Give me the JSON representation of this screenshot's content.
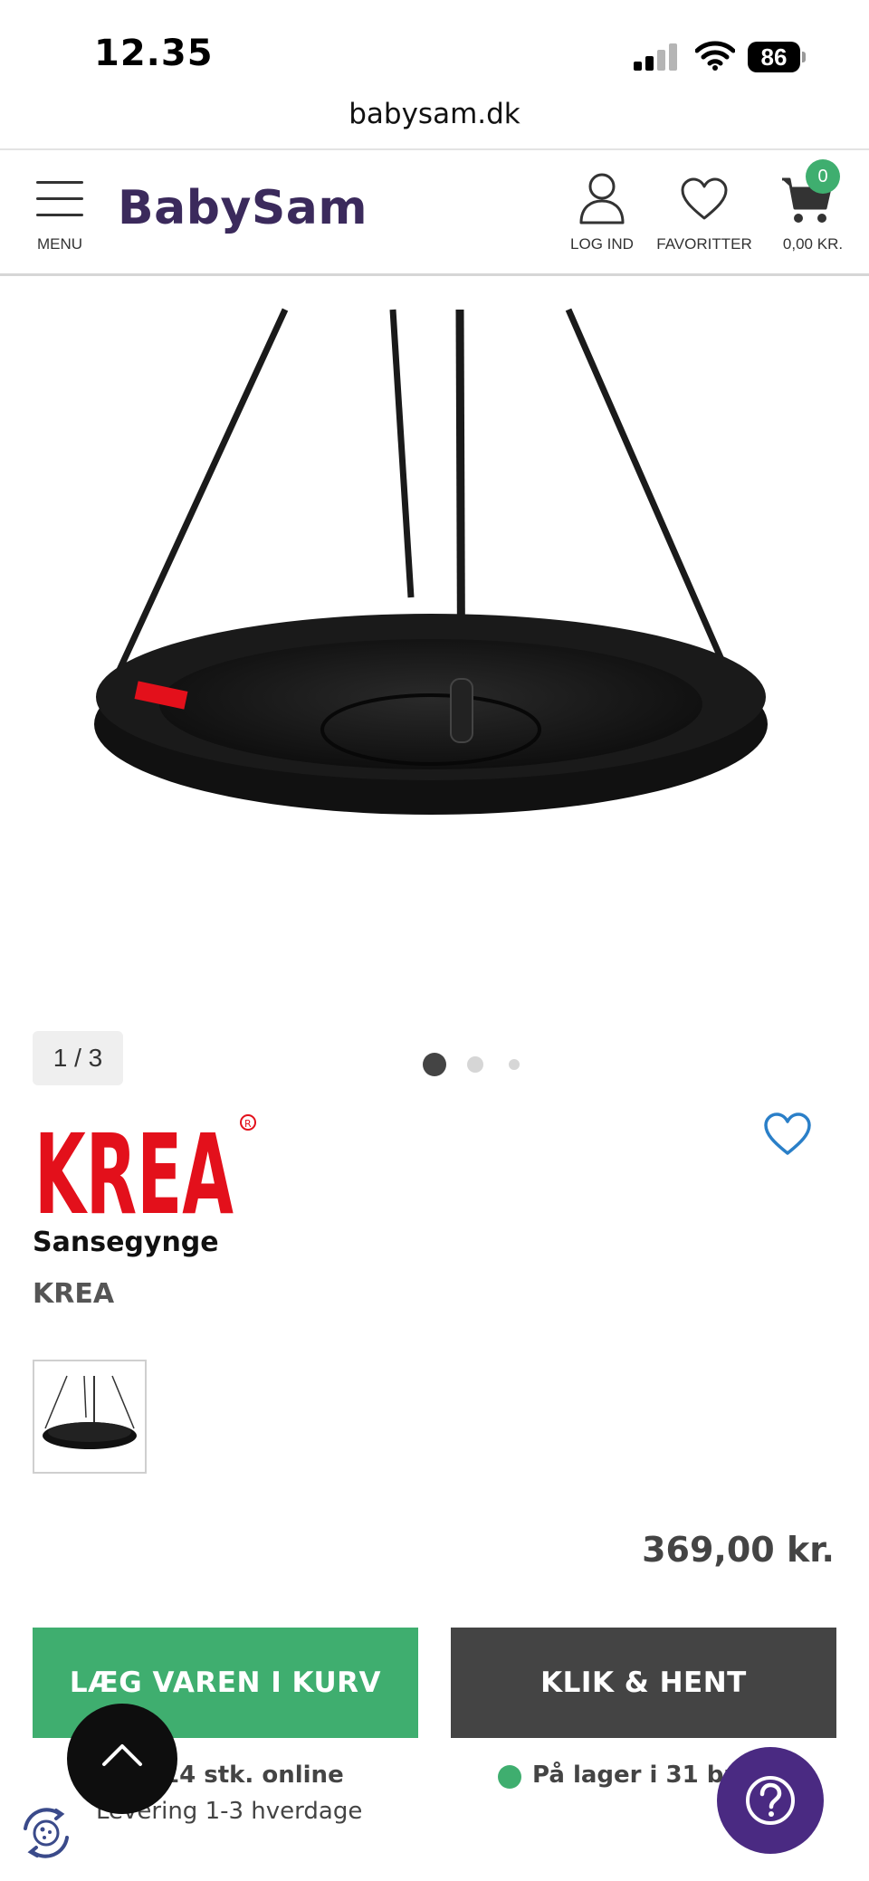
{
  "status_bar": {
    "time": "12.35",
    "battery": "86"
  },
  "browser": {
    "url": "babysam.dk"
  },
  "header": {
    "menu_label": "MENU",
    "logo_text": "BabySam",
    "login_label": "LOG IND",
    "favorites_label": "FAVORITTER",
    "cart_label": "0,00 KR.",
    "cart_count": "0"
  },
  "gallery": {
    "counter": "1 / 3",
    "slide_count": 3,
    "active_slide": 1
  },
  "product": {
    "brand_logo_text": "KREA",
    "name": "Sansegynge",
    "brand": "KREA",
    "price": "369,00 kr."
  },
  "actions": {
    "add_to_cart": "LÆG VAREN I KURV",
    "click_collect": "KLIK & HENT"
  },
  "availability": {
    "online_stock": "14 stk. online",
    "delivery": "Levering 1-3 hverdage",
    "store_stock": "På lager i 31 butikker"
  },
  "colors": {
    "brand_purple": "#3b2a5c",
    "green": "#3fae6f",
    "dark_button": "#444444",
    "help_button": "#4a2a82",
    "krea_red": "#e3101b"
  },
  "icons": {
    "menu": "hamburger-icon",
    "login": "user-icon",
    "favorites": "heart-icon",
    "cart": "cart-icon",
    "scroll_top": "chevron-up-icon",
    "help": "question-icon",
    "cookie": "cookie-icon"
  }
}
